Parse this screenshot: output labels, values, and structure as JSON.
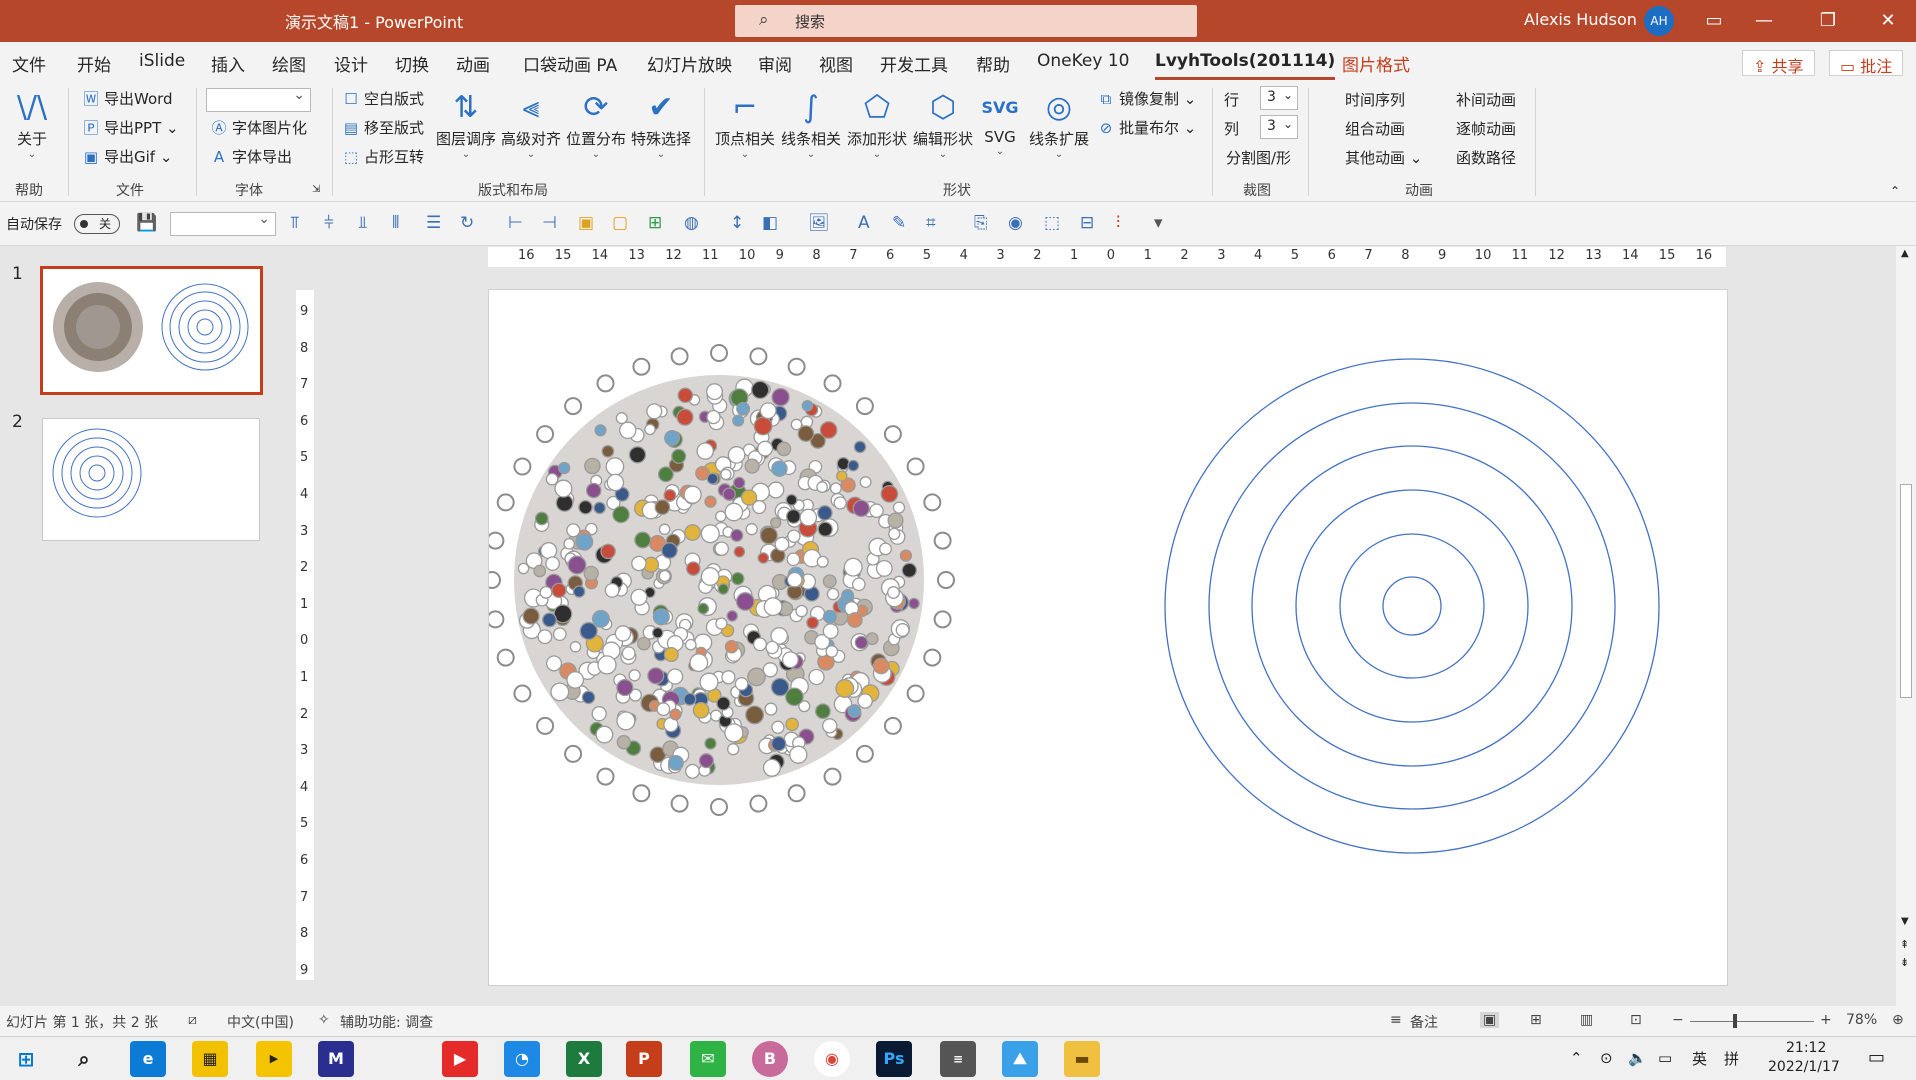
{
  "titlebar": {
    "doc_title": "演示文稿1  -  PowerPoint",
    "search_placeholder": "搜索",
    "user_name": "Alexis Hudson",
    "user_initials": "AH"
  },
  "tabs": [
    "文件",
    "开始",
    "iSlide",
    "插入",
    "绘图",
    "设计",
    "切换",
    "动画",
    "口袋动画 PA",
    "幻灯片放映",
    "审阅",
    "视图",
    "开发工具",
    "帮助",
    "OneKey 10",
    "LvyhTools(201114)",
    "图片格式"
  ],
  "active_tab": "LvyhTools(201114)",
  "header_buttons": {
    "share": "共享",
    "comment": "批注"
  },
  "ribbon": {
    "help": {
      "about": "关于",
      "group": "帮助"
    },
    "file": {
      "export_word": "导出Word",
      "export_ppt": "导出PPT",
      "export_gif": "导出Gif",
      "group": "文件"
    },
    "font": {
      "font_to_image": "字体图片化",
      "font_export": "字体导出",
      "group": "字体"
    },
    "layout": {
      "blank_layout": "空白版式",
      "move_layout": "移至版式",
      "placeholder_swap": "占形互转",
      "layer_order": "图层调序",
      "advanced_align": "高级对齐",
      "position_distribute": "位置分布",
      "special_select": "特殊选择",
      "group": "版式和布局"
    },
    "shape": {
      "vertex": "顶点相关",
      "line": "线条相关",
      "add_shape": "添加形状",
      "edit_shape": "编辑形状",
      "svg": "SVG",
      "line_extend": "线条扩展",
      "mirror_copy": "镜像复制",
      "batch_bool": "批量布尔",
      "group": "形状"
    },
    "crop": {
      "row_label": "行",
      "row_value": "3",
      "col_label": "列",
      "col_value": "3",
      "split": "分割图/形",
      "group": "裁图"
    },
    "animation": {
      "timeline": "时间序列",
      "combo": "组合动画",
      "other": "其他动画",
      "tween": "补间动画",
      "frame": "逐帧动画",
      "func_path": "函数路径",
      "group": "动画"
    }
  },
  "qat": {
    "autosave_label": "自动保存",
    "autosave_state": "关"
  },
  "thumbnails": [
    {
      "number": "1"
    },
    {
      "number": "2"
    }
  ],
  "h_ruler": [
    "16",
    "15",
    "14",
    "13",
    "12",
    "11",
    "10",
    "9",
    "8",
    "7",
    "6",
    "5",
    "4",
    "3",
    "2",
    "1",
    "0",
    "1",
    "2",
    "3",
    "4",
    "5",
    "6",
    "7",
    "8",
    "9",
    "10",
    "11",
    "12",
    "13",
    "14",
    "15",
    "16"
  ],
  "v_ruler": [
    "9",
    "8",
    "7",
    "6",
    "5",
    "4",
    "3",
    "2",
    "1",
    "0",
    "1",
    "2",
    "3",
    "4",
    "5",
    "6",
    "7",
    "8",
    "9"
  ],
  "statusbar": {
    "slide_info": "幻灯片 第 1 张，共 2 张",
    "language": "中文(中国)",
    "accessibility": "辅助功能: 调查",
    "notes": "备注",
    "zoom": "78%"
  },
  "taskbar": {
    "ime": "英",
    "time": "21:12",
    "date": "2022/1/17"
  },
  "colors": {
    "accent": "#b7472a",
    "ring": "#4472c4"
  }
}
